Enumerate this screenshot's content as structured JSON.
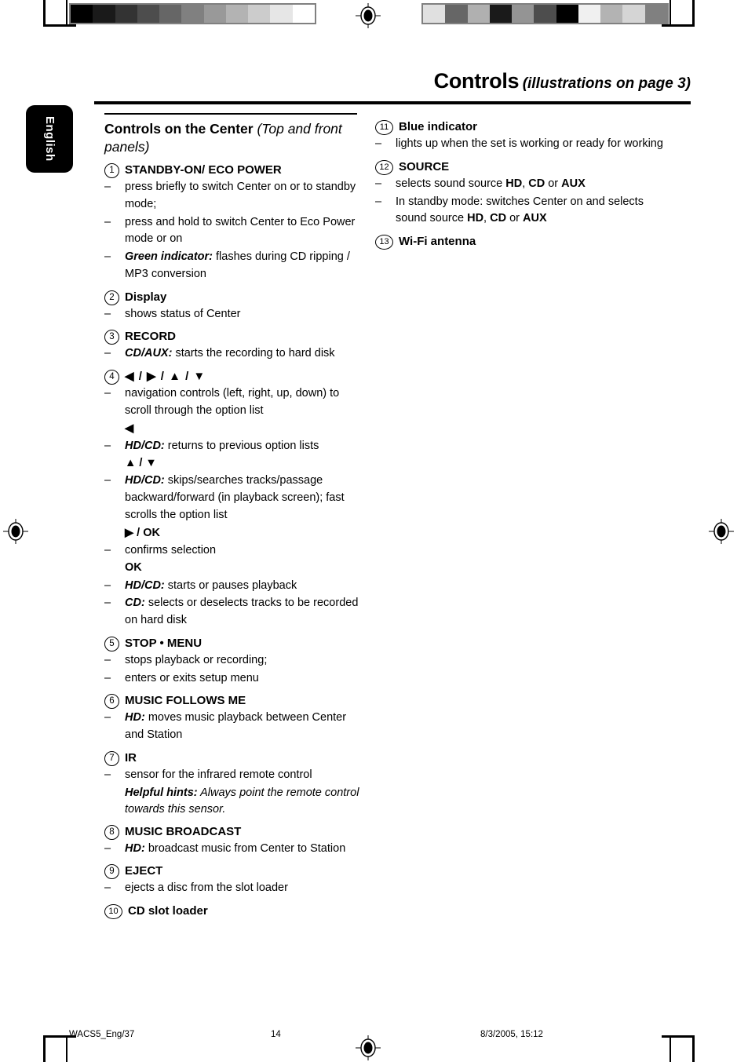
{
  "header": {
    "title_main": "Controls",
    "title_sub": "(illustrations on page 3)"
  },
  "language_tab": {
    "label": "English"
  },
  "calibration": {
    "left_bar": [
      "#000000",
      "#1a1a1a",
      "#333333",
      "#4d4d4d",
      "#666666",
      "#808080",
      "#999999",
      "#b3b3b3",
      "#cccccc",
      "#e6e6e6",
      "#ffffff"
    ],
    "right_bar": [
      "#e0e0e0",
      "#666666",
      "#b0b0b0",
      "#1a1a1a",
      "#949494",
      "#4d4d4d",
      "#000000",
      "#f0f0f0",
      "#b3b3b3",
      "#d5d5d5",
      "#808080"
    ]
  },
  "left_column": {
    "section_heading_bold": "Controls on the Center ",
    "section_heading_italic": "(Top and front panels)",
    "entries": [
      {
        "num": "1",
        "title": "STANDBY-ON/ ECO POWER",
        "lines": [
          {
            "kind": "bullet",
            "text": "press briefly to switch Center on or to standby mode;"
          },
          {
            "kind": "bullet",
            "text": "press and hold to switch Center to Eco Power mode or on"
          },
          {
            "kind": "bullet",
            "lead": "Green indicator:",
            "text": "flashes during CD ripping / MP3 conversion"
          }
        ]
      },
      {
        "num": "2",
        "title": "Display",
        "lines": [
          {
            "kind": "bullet",
            "text": "shows status of Center"
          }
        ]
      },
      {
        "num": "3",
        "title": "RECORD",
        "lines": [
          {
            "kind": "bullet",
            "lead": "CD/AUX:",
            "text": "starts the recording to hard disk"
          }
        ]
      },
      {
        "num": "4",
        "title": "◀ / ▶ / ▲ / ▼",
        "lines": [
          {
            "kind": "bullet",
            "text": "navigation controls (left, right, up, down) to scroll through the option list"
          },
          {
            "kind": "glyph",
            "text": "◀"
          },
          {
            "kind": "bullet",
            "lead": "HD/CD:",
            "text": "returns to previous option lists"
          },
          {
            "kind": "glyph",
            "text": "▲ / ▼"
          },
          {
            "kind": "bullet",
            "lead": "HD/CD:",
            "text": "skips/searches tracks/passage backward/forward (in playback screen); fast scrolls the option list"
          },
          {
            "kind": "glyph",
            "text": "▶ / OK"
          },
          {
            "kind": "bullet",
            "text": "confirms selection"
          },
          {
            "kind": "glyph",
            "text": "OK"
          },
          {
            "kind": "bullet",
            "lead": "HD/CD:",
            "text": "starts or pauses playback"
          },
          {
            "kind": "bullet",
            "lead": "CD:",
            "text": "selects or deselects tracks to be recorded on hard disk"
          }
        ]
      },
      {
        "num": "5",
        "title": " STOP • MENU",
        "lines": [
          {
            "kind": "bullet",
            "text": "stops playback or recording;"
          },
          {
            "kind": "bullet",
            "text": "enters or exits setup menu"
          }
        ]
      },
      {
        "num": "6",
        "title": "MUSIC FOLLOWS ME",
        "lines": [
          {
            "kind": "bullet",
            "lead": "HD:",
            "text": "moves music playback between Center and Station"
          }
        ]
      },
      {
        "num": "7",
        "title": "IR",
        "lines": [
          {
            "kind": "bullet",
            "text": "sensor for the infrared remote control"
          },
          {
            "kind": "hint",
            "lead": "Helpful hints:",
            "text": " Always point the remote control towards this sensor."
          }
        ]
      },
      {
        "num": "8",
        "title": "MUSIC BROADCAST",
        "lines": [
          {
            "kind": "bullet",
            "lead": "HD:",
            "text": "broadcast music from Center to Station"
          }
        ]
      },
      {
        "num": "9",
        "title": "EJECT",
        "lines": [
          {
            "kind": "bullet",
            "text": "ejects a disc from the slot loader"
          }
        ]
      },
      {
        "num": "10",
        "title": "CD slot loader",
        "lines": []
      }
    ]
  },
  "right_column": {
    "entries": [
      {
        "num": "11",
        "title": "Blue indicator",
        "lines": [
          {
            "kind": "bullet",
            "text": " lights up when the set is working or ready for working"
          }
        ]
      },
      {
        "num": "12",
        "title": "SOURCE",
        "lines": [
          {
            "kind": "bullet",
            "text": "selects sound source HD, CD or AUX",
            "bold_tokens": [
              "HD",
              "CD",
              "AUX"
            ]
          },
          {
            "kind": "bullet",
            "text": "In standby mode: switches Center on and selects sound source HD, CD or AUX",
            "bold_tokens": [
              "HD",
              "CD",
              "AUX"
            ]
          }
        ]
      },
      {
        "num": "13",
        "title": " Wi-Fi antenna",
        "lines": []
      }
    ]
  },
  "footer": {
    "file": "WACS5_Eng/37",
    "page": "14",
    "date": "8/3/2005, 15:12"
  },
  "symbols": {
    "dash": "–",
    "left_triangle": "◀",
    "right_triangle": "▶",
    "up_triangle": "▲",
    "down_triangle": "▼"
  }
}
